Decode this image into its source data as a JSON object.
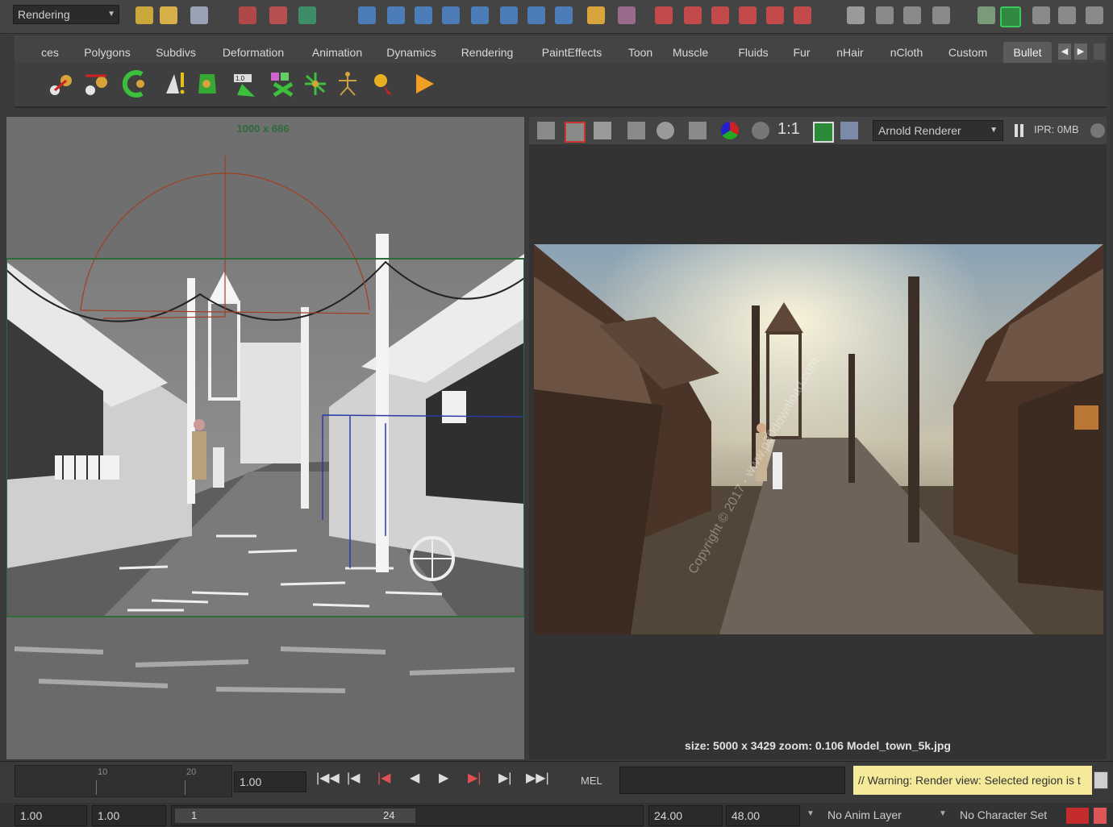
{
  "top_toolbar": {
    "mode_select": "Rendering"
  },
  "shelf_tabs": [
    "ces",
    "Polygons",
    "Subdivs",
    "Deformation",
    "Animation",
    "Dynamics",
    "Rendering",
    "PaintEffects",
    "Toon",
    "Muscle",
    "Fluids",
    "Fur",
    "nHair",
    "nCloth",
    "Custom",
    "Bullet"
  ],
  "active_tab": "Bullet",
  "viewport": {
    "resolution_label": "1000 x 686"
  },
  "render_view": {
    "renderer": "Arnold Renderer",
    "ratio_label": "1:1",
    "ipr_label": "IPR: 0MB",
    "status": "size: 5000 x 3429  zoom: 0.106   Model_town_5k.jpg",
    "watermark": "Copyright © 2017 - www.p30download.com"
  },
  "timeline": {
    "ticks": [
      "10",
      "20"
    ],
    "current_frame": "1.00",
    "script_lang": "MEL",
    "warning": "// Warning: Render view: Selected region is t"
  },
  "range_bar": {
    "start_time": "1.00",
    "playback_start": "1.00",
    "range_start": "1",
    "range_end": "24",
    "playback_end": "24.00",
    "end_time": "48.00",
    "anim_layer": "No Anim Layer",
    "character_set": "No Character Set"
  },
  "colors": {
    "panel_bg": "#444444",
    "field_bg": "#2a2a2a",
    "warning_bg": "#f5e99a",
    "resolution_gate": "#2e6b3a"
  }
}
